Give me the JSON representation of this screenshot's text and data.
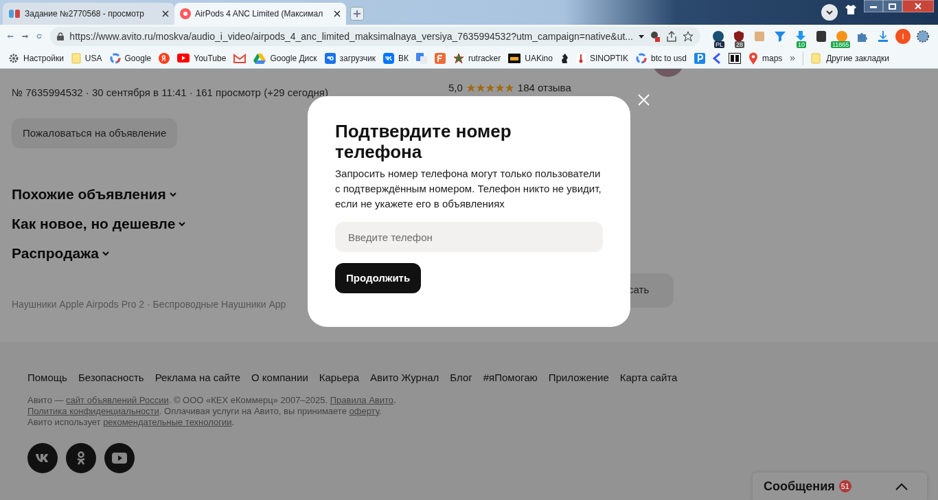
{
  "browser": {
    "tabs": [
      {
        "title": "Задание №2770568 - просмотр",
        "selected": false
      },
      {
        "title": "AirPods 4 ANC Limited (Максимал",
        "selected": true
      }
    ],
    "url": "https://www.avito.ru/moskva/audio_i_video/airpods_4_anc_limited_maksimalnaya_versiya_7635994532?utm_campaign=native&ut...",
    "extension_badges": [
      "PL",
      "28",
      "10",
      "11865"
    ],
    "profile_initial": "I",
    "bookmarks": [
      {
        "kind": "labeled",
        "label": "Настройки"
      },
      {
        "kind": "labeled",
        "label": "USA"
      },
      {
        "kind": "labeled",
        "label": "Google"
      },
      {
        "kind": "icon"
      },
      {
        "kind": "labeled",
        "label": "YouTube"
      },
      {
        "kind": "icon"
      },
      {
        "kind": "labeled",
        "label": "Google Диск"
      },
      {
        "kind": "labeled",
        "label": "загрузчик"
      },
      {
        "kind": "labeled",
        "label": "ВК"
      },
      {
        "kind": "icon"
      },
      {
        "kind": "icon"
      },
      {
        "kind": "labeled",
        "label": "rutracker"
      },
      {
        "kind": "labeled",
        "label": "UAKino"
      },
      {
        "kind": "icon"
      },
      {
        "kind": "labeled",
        "label": "SINOPTIK"
      },
      {
        "kind": "labeled",
        "label": "btc to usd"
      },
      {
        "kind": "icon"
      },
      {
        "kind": "icon"
      },
      {
        "kind": "icon"
      },
      {
        "kind": "labeled",
        "label": "maps"
      }
    ],
    "more": "»",
    "other_bookmarks": "Другие закладки"
  },
  "page": {
    "meta": "№ 7635994532 · 30 сентября в 11:41 · 161 просмотр (+29 сегодня)",
    "report_button": "Пожаловаться на объявление",
    "sections": [
      {
        "title": "Похожие объявления"
      },
      {
        "title": "Как новое, но дешевле"
      },
      {
        "title": "Распродажа"
      }
    ],
    "breadcrumbs": "Наушники Apple Airpods Pro 2 · Беспроводные Наушники App",
    "seller": {
      "rating": "5,0",
      "stars": 5,
      "reviews": "184 отзыва"
    },
    "message_button": "сать"
  },
  "footer": {
    "links": [
      "Помощь",
      "Безопасность",
      "Реклама на сайте",
      "О компании",
      "Карьера",
      "Авито Журнал",
      "Блог",
      "#яПомогаю",
      "Приложение",
      "Карта сайта"
    ],
    "legal": [
      [
        {
          "text": "Авито — "
        },
        {
          "text": "сайт объявлений России",
          "link": true
        },
        {
          "text": ". © ООО «КЕХ еКоммерц» 2007–2025. "
        },
        {
          "text": "Правила Авито",
          "link": true
        },
        {
          "text": "."
        }
      ],
      [
        {
          "text": "Политика конфиденциальности",
          "link": true
        },
        {
          "text": ". Оплачивая услуги на Авито, вы принимаете "
        },
        {
          "text": "оферту",
          "link": true
        },
        {
          "text": "."
        }
      ],
      [
        {
          "text": "Авито использует "
        },
        {
          "text": "рекомендательные технологии",
          "link": true
        },
        {
          "text": "."
        }
      ]
    ]
  },
  "modal": {
    "title": "Подтвердите номер телефона",
    "text": "Запросить номер телефона могут только пользователи с подтверждённым номером. Телефон никто не увидит, если не укажете его в объявлениях",
    "placeholder": "Введите телефон",
    "button": "Продолжить"
  },
  "messages": {
    "label": "Сообщения",
    "count": "51"
  }
}
